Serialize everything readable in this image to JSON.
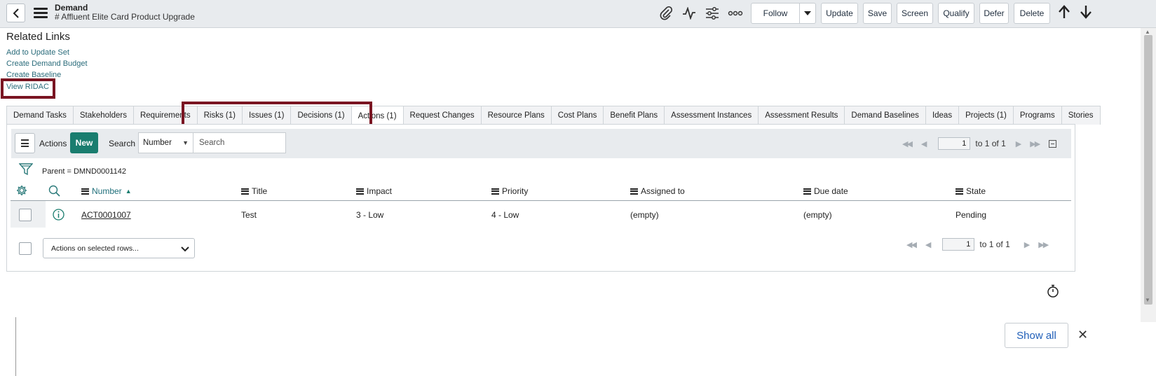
{
  "header": {
    "back_icon": "chevron-left-icon",
    "menu_icon": "hamburger-icon",
    "table_label": "Demand",
    "record_title": "# Affluent Elite Card Product Upgrade",
    "icons": [
      "paperclip-icon",
      "activity-icon",
      "sliders-icon",
      "more-icon"
    ],
    "follow_label": "Follow",
    "update_label": "Update",
    "save_label": "Save",
    "screen_label": "Screen",
    "qualify_label": "Qualify",
    "defer_label": "Defer",
    "delete_label": "Delete"
  },
  "related": {
    "title": "Related Links",
    "links": [
      "Add to Update Set",
      "Create Demand Budget",
      "Create Baseline",
      "View RIDAC"
    ]
  },
  "tabs": [
    "Demand Tasks",
    "Stakeholders",
    "Requirements",
    "Risks (1)",
    "Issues (1)",
    "Decisions (1)",
    "Actions (1)",
    "Request Changes",
    "Resource Plans",
    "Cost Plans",
    "Benefit Plans",
    "Assessment Instances",
    "Assessment Results",
    "Demand Baselines",
    "Ideas",
    "Projects (1)",
    "Programs",
    "Stories"
  ],
  "active_tab": "Actions (1)",
  "list": {
    "title": "Actions",
    "new_label": "New",
    "search_label": "Search",
    "search_field": "Number",
    "search_placeholder": "Search",
    "page_value": "1",
    "page_range": "to 1 of 1",
    "filter_text": "Parent = DMND0001142",
    "columns": [
      "Number",
      "Title",
      "Impact",
      "Priority",
      "Assigned to",
      "Due date",
      "State"
    ],
    "rows": [
      {
        "number": "ACT0001007",
        "title": "Test",
        "impact": "3 - Low",
        "priority": "4 - Low",
        "assigned_to": "(empty)",
        "due_date": "(empty)",
        "state": "Pending"
      }
    ],
    "actions_placeholder": "Actions on selected rows...",
    "bottom_page_value": "1",
    "bottom_page_range": "to 1 of 1"
  },
  "footer": {
    "show_all": "Show all",
    "close_icon": "close-icon",
    "timer_icon": "stopwatch-icon"
  },
  "colors": {
    "accent_green": "#1a7d6f",
    "link_teal": "#2b6c7b",
    "highlight_box": "#7a1522",
    "show_all_blue": "#1f5eb8"
  }
}
